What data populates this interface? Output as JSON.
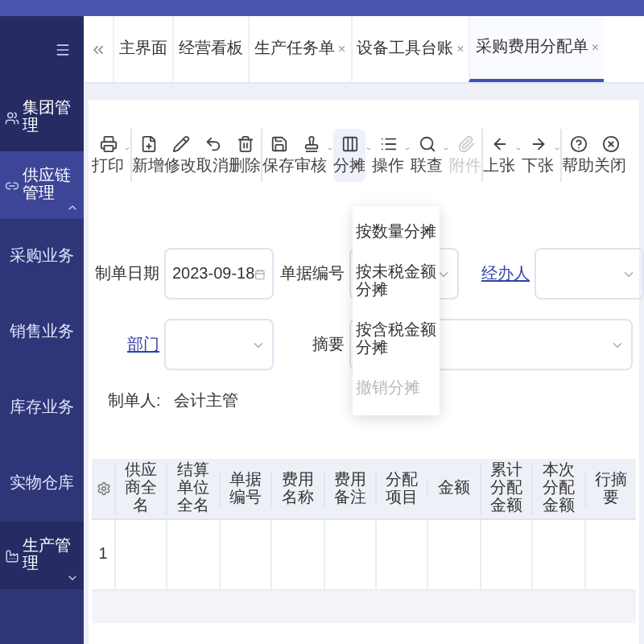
{
  "sidebar": {
    "items": [
      {
        "label": "集团管理",
        "kind": "module",
        "selected": false
      },
      {
        "label": "供应链管理",
        "kind": "group",
        "expanded": true,
        "selected": true,
        "children": [
          {
            "label": "采购业务"
          },
          {
            "label": "销售业务"
          },
          {
            "label": "库存业务"
          },
          {
            "label": "实物仓库"
          }
        ]
      },
      {
        "label": "生产管理",
        "kind": "group",
        "expanded": false,
        "selected": false
      }
    ]
  },
  "tabs": [
    {
      "label": "主界面",
      "selected": false
    },
    {
      "label": "经营看板",
      "selected": false
    },
    {
      "label": "生产任务单",
      "close": "×",
      "selected": false
    },
    {
      "label": "设备工具台账",
      "close": "×",
      "selected": false
    },
    {
      "label": "采购费用分配单",
      "close": "×",
      "selected": true
    }
  ],
  "toolbar": {
    "groups": [
      [
        {
          "label": "打印",
          "dropdown": true,
          "disabled": false,
          "expanded": false
        }
      ],
      [
        {
          "label": "新增",
          "dropdown": false,
          "disabled": false,
          "expanded": false
        },
        {
          "label": "修改",
          "dropdown": false,
          "disabled": false,
          "expanded": false
        },
        {
          "label": "取消",
          "dropdown": false,
          "disabled": false,
          "expanded": false
        },
        {
          "label": "删除",
          "dropdown": false,
          "disabled": false,
          "expanded": false
        }
      ],
      [
        {
          "label": "保存",
          "dropdown": false,
          "disabled": false,
          "expanded": false
        },
        {
          "label": "审核",
          "dropdown": true,
          "disabled": false,
          "expanded": false
        },
        {
          "label": "分摊",
          "dropdown": true,
          "disabled": false,
          "expanded": true
        },
        {
          "label": "操作",
          "dropdown": true,
          "disabled": false,
          "expanded": false
        },
        {
          "label": "联查",
          "dropdown": true,
          "disabled": false,
          "expanded": false
        },
        {
          "label": "附件",
          "dropdown": false,
          "disabled": true,
          "expanded": false
        }
      ],
      [
        {
          "label": "上张",
          "dropdown": true,
          "disabled": false,
          "expanded": false
        },
        {
          "label": "下张",
          "dropdown": true,
          "disabled": false,
          "expanded": false
        }
      ],
      [
        {
          "label": "帮助",
          "dropdown": false,
          "disabled": false,
          "expanded": false
        },
        {
          "label": "关闭",
          "dropdown": false,
          "disabled": false,
          "expanded": false
        }
      ]
    ]
  },
  "menu": {
    "items": [
      {
        "label": "按数量分摊",
        "disabled": false
      },
      {
        "label": "按未税金额分摊",
        "disabled": false
      },
      {
        "label": "按含税金额分摊",
        "disabled": false
      },
      {
        "label": "撤销分摊",
        "disabled": true
      }
    ]
  },
  "form": {
    "rows": [
      [
        {
          "label": "制单日期",
          "kind": "date",
          "value": "2023-09-18",
          "link": false
        },
        {
          "label": "单据编号",
          "kind": "select",
          "link": false
        },
        {
          "label": "经办人",
          "kind": "select",
          "link": true
        }
      ],
      [
        {
          "label": "部门",
          "kind": "select",
          "link": true
        },
        {
          "label": "摘要",
          "kind": "wide",
          "link": false
        }
      ]
    ],
    "creator": {
      "label": "制单人:",
      "value": "会计主管"
    }
  },
  "table": {
    "columns": [
      "供应商全名",
      "结算单位全名",
      "单据编号",
      "费用名称",
      "费用备注",
      "分配项目",
      "金额",
      "累计分配金额",
      "本次分配金额",
      "行摘要"
    ],
    "rows": [
      {
        "number": "1"
      }
    ]
  }
}
